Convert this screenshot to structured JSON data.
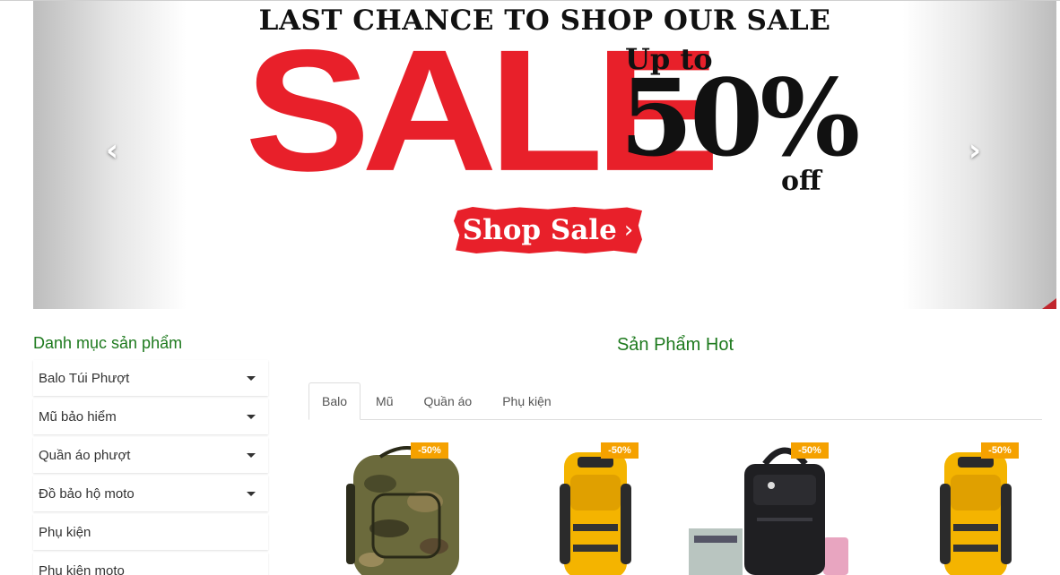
{
  "banner": {
    "headline": "LAST CHANCE TO SHOP OUR SALE",
    "sale_word": "SALE",
    "up_to": "Up to",
    "percent": "50%",
    "off": "off",
    "cta_label": "Shop Sale",
    "prev_icon": "chevron-left-icon",
    "next_icon": "chevron-right-icon",
    "colors": {
      "sale_red": "#e8202a",
      "text": "#111111"
    }
  },
  "sidebar": {
    "title": "Danh mục sản phẩm",
    "items": [
      {
        "label": "Balo Túi Phượt",
        "has_submenu": true
      },
      {
        "label": "Mũ bảo hiểm",
        "has_submenu": true
      },
      {
        "label": "Quần áo phượt",
        "has_submenu": true
      },
      {
        "label": "Đồ bảo hộ moto",
        "has_submenu": true
      },
      {
        "label": "Phụ kiện",
        "has_submenu": false
      },
      {
        "label": "Phụ kiện moto",
        "has_submenu": false
      }
    ]
  },
  "hot": {
    "title": "Sản Phẩm Hot",
    "tabs": [
      {
        "label": "Balo",
        "active": true
      },
      {
        "label": "Mũ",
        "active": false
      },
      {
        "label": "Quần áo",
        "active": false
      },
      {
        "label": "Phụ kiện",
        "active": false
      }
    ],
    "products": [
      {
        "badge": "-50%",
        "image": "camo-backpack"
      },
      {
        "badge": "-50%",
        "image": "yellow-hiking-backpack"
      },
      {
        "badge": "-50%",
        "image": "black-laptop-backpack"
      },
      {
        "badge": "-50%",
        "image": "yellow-hiking-backpack"
      }
    ],
    "colors": {
      "title_green": "#1e7a1e",
      "badge_orange": "#f5a100"
    }
  }
}
